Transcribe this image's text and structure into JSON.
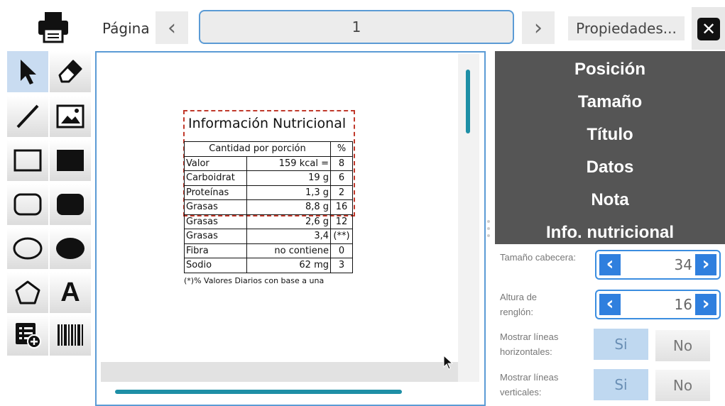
{
  "toolbar": {
    "print_icon": "printer-icon",
    "page_label": "Página",
    "prev_label": "‹",
    "next_label": "›",
    "page_value": "1",
    "properties_label": "Propiedades...",
    "close_label": "✕"
  },
  "tools": [
    {
      "name": "select-tool",
      "icon": "arrow-icon"
    },
    {
      "name": "eraser-tool",
      "icon": "eraser-icon"
    },
    {
      "name": "line-tool",
      "icon": "line-icon"
    },
    {
      "name": "image-tool",
      "icon": "image-icon"
    },
    {
      "name": "rectangle-tool",
      "icon": "rectangle-outline-icon"
    },
    {
      "name": "filled-rectangle-tool",
      "icon": "rectangle-filled-icon"
    },
    {
      "name": "rounded-rect-tool",
      "icon": "rounded-rect-outline-icon"
    },
    {
      "name": "filled-rounded-rect-tool",
      "icon": "rounded-rect-filled-icon"
    },
    {
      "name": "ellipse-tool",
      "icon": "ellipse-outline-icon"
    },
    {
      "name": "filled-ellipse-tool",
      "icon": "ellipse-filled-icon"
    },
    {
      "name": "polygon-tool",
      "icon": "pentagon-icon"
    },
    {
      "name": "text-tool",
      "icon": "text-icon",
      "label": "A"
    },
    {
      "name": "add-table-tool",
      "icon": "table-add-icon"
    },
    {
      "name": "barcode-tool",
      "icon": "barcode-icon"
    }
  ],
  "nutrition": {
    "title": "Información Nutricional",
    "header": {
      "serving": "Cantidad por porción",
      "pct": "%"
    },
    "rows": [
      {
        "name": "Valor",
        "amount": "159 kcal =",
        "pct": "8"
      },
      {
        "name": "Carboidrat",
        "amount": "19 g",
        "pct": "6"
      },
      {
        "name": "Proteínas",
        "amount": "1,3 g",
        "pct": "2"
      },
      {
        "name": "Grasas",
        "amount": "8,8 g",
        "pct": "16"
      },
      {
        "name": "Grasas",
        "amount": "2,6 g",
        "pct": "12"
      },
      {
        "name": "Grasas",
        "amount": "3,4",
        "pct": "(**)"
      },
      {
        "name": "Fibra",
        "amount": "no contiene",
        "pct": "0"
      },
      {
        "name": "Sodio",
        "amount": "62 mg",
        "pct": "3"
      }
    ],
    "footnote": "(*)% Valores Diarios con base a una"
  },
  "menu": {
    "items": [
      "Posición",
      "Tamaño",
      "Título",
      "Datos",
      "Nota",
      "Info. nutricional"
    ]
  },
  "properties": {
    "header_size": {
      "label": "Tamaño cabecera:",
      "value": "34"
    },
    "row_height": {
      "label": "Altura de renglón:",
      "value": "16"
    },
    "horizontal_lines": {
      "label": "Mostrar líneas horizontales:",
      "yes": "Si",
      "no": "No"
    },
    "vertical_lines": {
      "label": "Mostrar líneas verticales:",
      "yes": "Si",
      "no": "No"
    }
  },
  "colors": {
    "accent": "#5b9bd5",
    "scroll": "#1e8fa6",
    "panel": "#555555",
    "spinner": "#2f7fde",
    "selection": "#c0392b"
  }
}
